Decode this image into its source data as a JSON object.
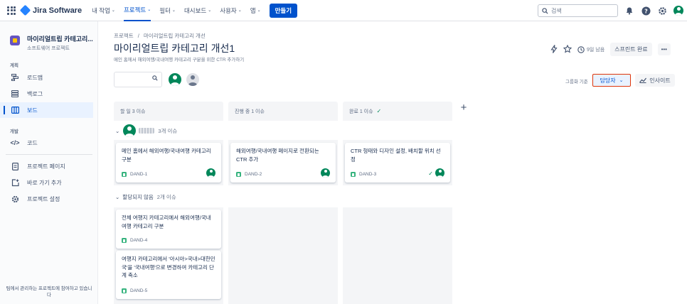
{
  "topnav": {
    "logo_text": "Jira Software",
    "items": [
      {
        "label": "내 작업",
        "chevron": "⌄"
      },
      {
        "label": "프로젝트",
        "chevron": "⌄"
      },
      {
        "label": "필터",
        "chevron": "⌄"
      },
      {
        "label": "대시보드",
        "chevron": "⌄"
      },
      {
        "label": "사용자",
        "chevron": "⌄"
      },
      {
        "label": "앱",
        "chevron": "⌄"
      }
    ],
    "create_label": "만들기",
    "search_placeholder": "검색",
    "icons": [
      "bell-icon",
      "help-icon",
      "settings-icon",
      "profile-icon"
    ]
  },
  "sidebar": {
    "project_name": "마이리얼트립 카테고리...",
    "project_type": "소프트웨어 프로젝트",
    "planning_label": "계획",
    "planning_items": [
      {
        "label": "로드맵",
        "icon": "roadmap-icon"
      },
      {
        "label": "백로그",
        "icon": "backlog-icon"
      },
      {
        "label": "보드",
        "icon": "board-icon",
        "selected": true
      }
    ],
    "dev_label": "개발",
    "dev_items": [
      {
        "label": "코드",
        "icon": "code-icon"
      }
    ],
    "other_items": [
      {
        "label": "프로젝트 페이지",
        "icon": "page-icon"
      },
      {
        "label": "바로 가기 추가",
        "icon": "add-shortcut-icon"
      },
      {
        "label": "프로젝트 설정",
        "icon": "gear-icon"
      }
    ],
    "footer": "팀에서 관리하는 프로젝트에 참여하고 있습니다"
  },
  "header": {
    "breadcrumb_root": "프로젝트",
    "breadcrumb_sep": "/",
    "breadcrumb_current": "마이리얼트립 카테고리 개선",
    "title": "마이리얼트립 카테고리 개선1",
    "subtitle": "메인 홈에서 해외여행/국내여행 카테고리 구분을 위한 CTR 추가하기",
    "days_left": "9일 남음",
    "complete_sprint": "스프린트 완료",
    "more": "•••"
  },
  "toolbar": {
    "group_by_label": "그룹화 기준",
    "group_by_value": "담당자",
    "insights": "인사이트"
  },
  "columns": [
    {
      "label": "할 일 3 이슈"
    },
    {
      "label": "진행 중 1 이슈"
    },
    {
      "label": "완료 1 이슈",
      "done_mark": "✓"
    }
  ],
  "swimlanes": [
    {
      "count": "3개 이슈"
    },
    {
      "label": "할당되지 않음",
      "count": "2개 이슈"
    }
  ],
  "cards": [
    {
      "title": "메인 홈에서 해외여행/국내여행 카테고리 구분",
      "key": "DAND-1"
    },
    {
      "title": "해외여행/국내여행 페이지로 전환되는 CTR 추가",
      "key": "DAND-2"
    },
    {
      "title": "CTR 형태와 디자인 설정, 배치할 위치 선정",
      "key": "DAND-3",
      "done": "✓"
    },
    {
      "title": "전체 여행지 카테고리에서 해외여행/국내여행 카테고리 구분",
      "key": "DAND-4"
    },
    {
      "title": "여행지 카테고리에서 '아시아>국내>대한민국'을 '국내여행'으로 변경하여 카테고리 단계 축소",
      "key": "DAND-5"
    }
  ],
  "colors": {
    "accent": "#0052cc",
    "highlight_border": "#de350b",
    "avatar": "#00875a",
    "story": "#36b37e"
  }
}
